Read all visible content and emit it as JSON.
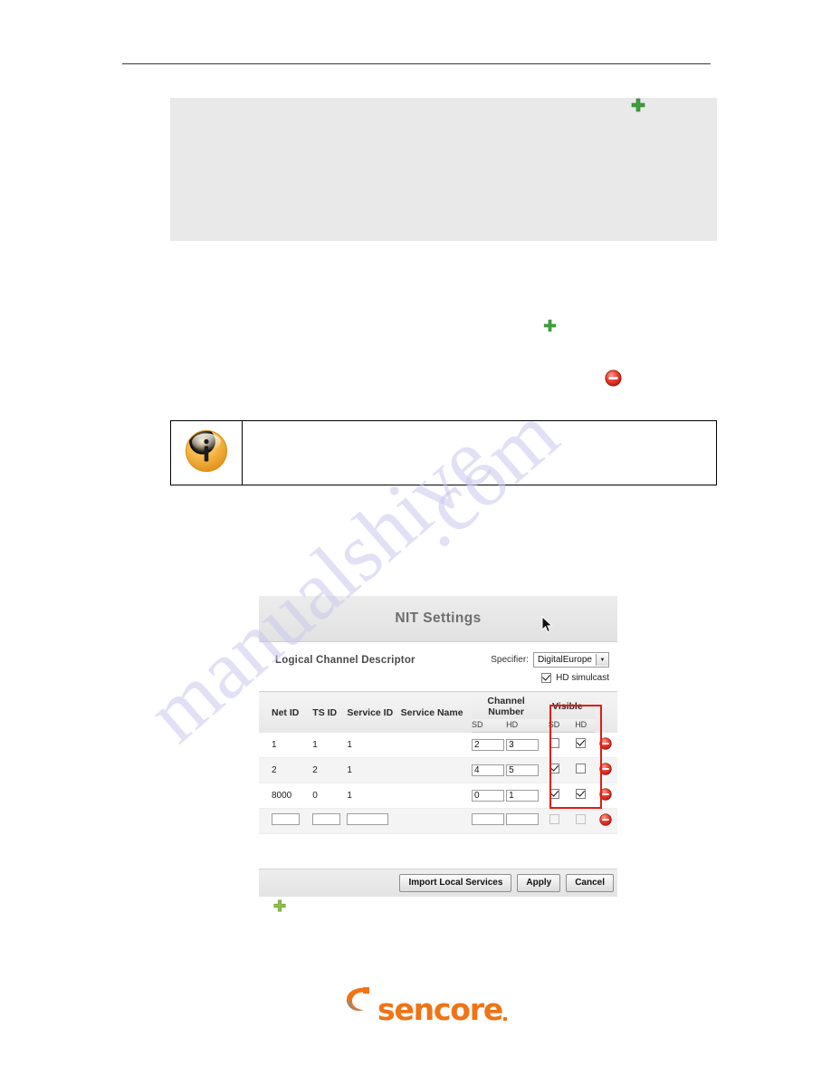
{
  "page": {
    "watermark_left": "manualshive",
    "watermark_right": ".com"
  },
  "icons": {
    "plus_top": "plus-icon",
    "plus_middle": "plus-icon",
    "plus_bottom": "plus-icon",
    "minus_middle": "minus-circle-icon",
    "info": "info-icon",
    "cursor": "mouse-cursor"
  },
  "colors": {
    "accent_green": "#3f9c3f",
    "accent_red": "#e02b20",
    "highlight_red": "#e31b13",
    "brand_orange": "#f07316",
    "panel_gray": "#e9e9e9"
  },
  "nit_panel": {
    "title": "NIT Settings",
    "section_label": "Logical Channel Descriptor",
    "specifier": {
      "label": "Specifier:",
      "value": "DigitalEurope",
      "arrow": "▼"
    },
    "hd_simulcast": {
      "label": "HD simulcast",
      "checked": true
    },
    "table": {
      "group_headers": {
        "net_id": "Net ID",
        "ts_id": "TS ID",
        "service_id": "Service ID",
        "service_name": "Service Name",
        "channel_number": "Channel Number",
        "visible": "Visible"
      },
      "sub_headers": {
        "cn_sd": "SD",
        "cn_hd": "HD",
        "vis_sd": "SD",
        "vis_hd": "HD"
      },
      "rows": [
        {
          "net_id": "1",
          "ts_id": "1",
          "service_id": "1",
          "service_name": "",
          "cn_sd": "2",
          "cn_hd": "3",
          "vis_sd": false,
          "vis_hd": true,
          "editable": false,
          "disabled_checks": false
        },
        {
          "net_id": "2",
          "ts_id": "2",
          "service_id": "1",
          "service_name": "",
          "cn_sd": "4",
          "cn_hd": "5",
          "vis_sd": true,
          "vis_hd": false,
          "editable": false,
          "disabled_checks": false
        },
        {
          "net_id": "8000",
          "ts_id": "0",
          "service_id": "1",
          "service_name": "",
          "cn_sd": "0",
          "cn_hd": "1",
          "vis_sd": true,
          "vis_hd": true,
          "editable": false,
          "disabled_checks": false
        },
        {
          "net_id": "",
          "ts_id": "",
          "service_id": "",
          "service_name": "",
          "cn_sd": "",
          "cn_hd": "",
          "vis_sd": false,
          "vis_hd": false,
          "editable": true,
          "disabled_checks": true
        }
      ]
    },
    "buttons": {
      "import": "Import Local Services",
      "apply": "Apply",
      "cancel": "Cancel"
    }
  },
  "footer": {
    "logo_text": "sencore"
  }
}
